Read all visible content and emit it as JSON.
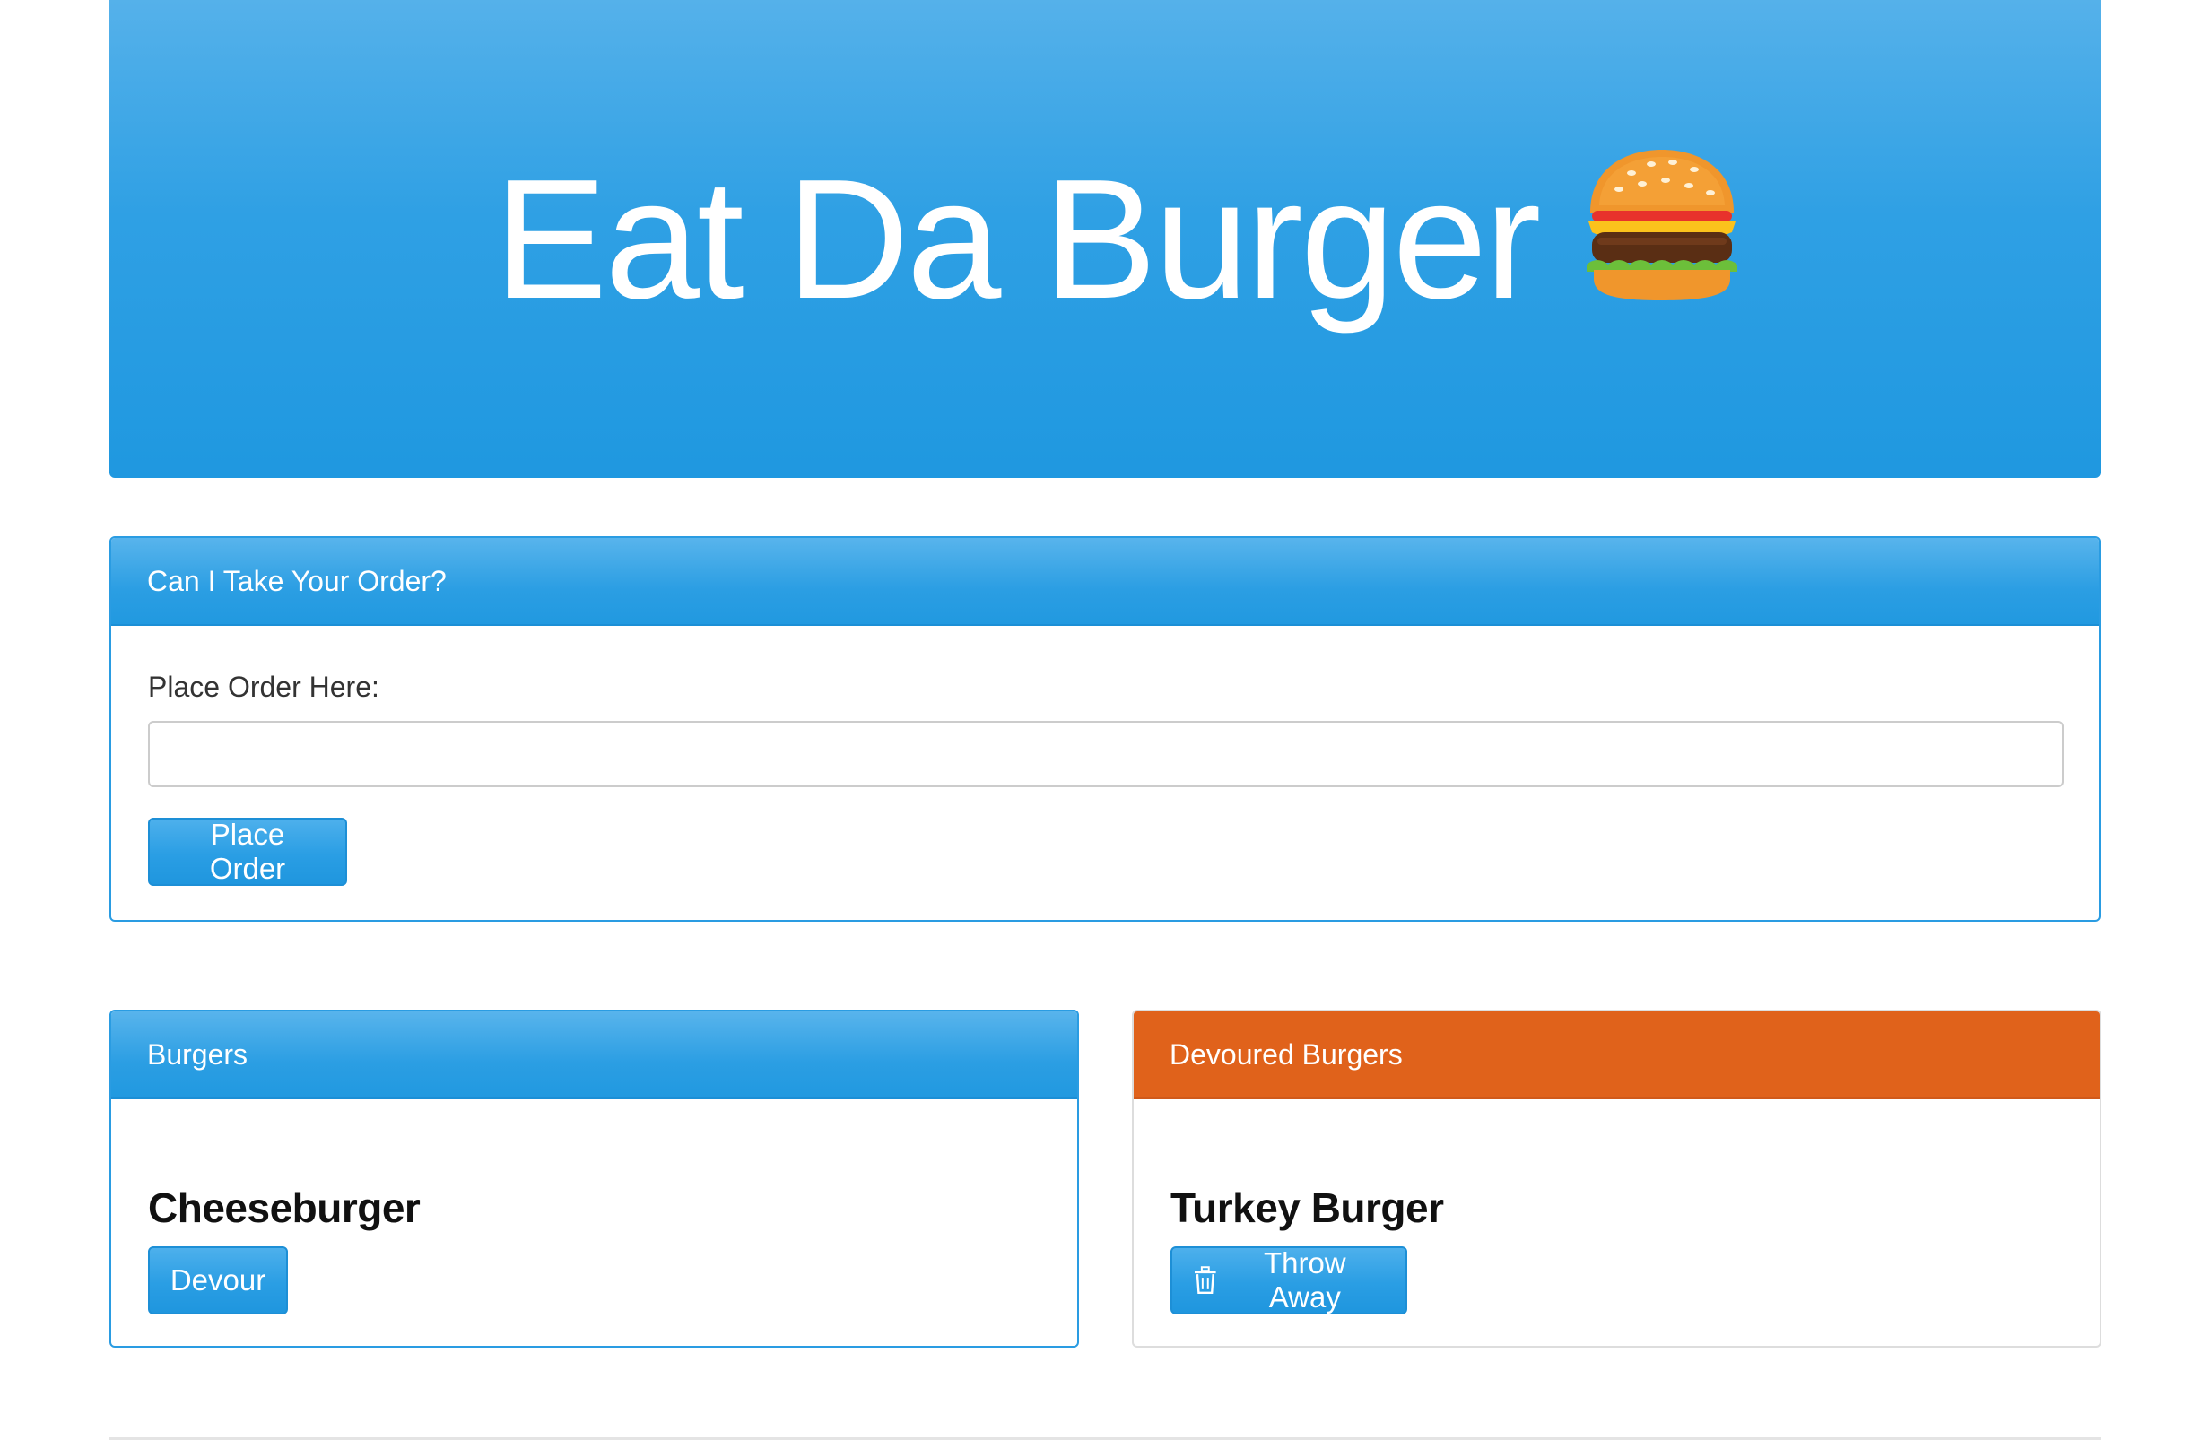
{
  "jumbotron": {
    "title": "Eat Da Burger",
    "icon": "burger-emoji"
  },
  "order_panel": {
    "heading": "Can I Take Your Order?",
    "field_label": "Place Order Here:",
    "input_value": "",
    "input_placeholder": "",
    "submit_label": "Place Order"
  },
  "burgers_panel": {
    "heading": "Burgers",
    "items": [
      {
        "name": "Cheeseburger",
        "action_label": "Devour"
      }
    ]
  },
  "devoured_panel": {
    "heading": "Devoured Burgers",
    "items": [
      {
        "name": "Turkey Burger",
        "action_label": "Throw Away",
        "action_icon": "trash-icon"
      }
    ]
  },
  "colors": {
    "primary": "#2a9ce2",
    "warning": "#e0621b",
    "text": "#333333"
  }
}
